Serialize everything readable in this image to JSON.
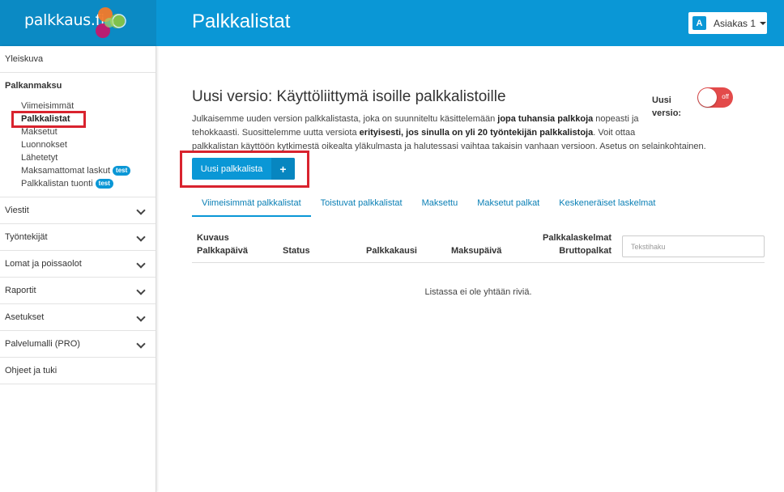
{
  "app": {
    "logo_text": "palkkaus.fi",
    "page_title": "Palkkalistat",
    "account_badge": "A",
    "account_name": "Asiakas 1",
    "brand_color": "#0a97d6"
  },
  "sidebar": {
    "items": [
      {
        "label": "Yleiskuva"
      },
      {
        "label": "Viestit"
      },
      {
        "label": "Työntekijät"
      },
      {
        "label": "Lomat ja poissaolot"
      },
      {
        "label": "Raportit"
      },
      {
        "label": "Asetukset"
      },
      {
        "label": "Palvelumalli (PRO)"
      },
      {
        "label": "Ohjeet ja tuki"
      }
    ],
    "group": {
      "label": "Palkanmaksu",
      "subitems": [
        {
          "label": "Viimeisimmät"
        },
        {
          "label": "Palkkalistat"
        },
        {
          "label": "Maksetut"
        },
        {
          "label": "Luonnokset"
        },
        {
          "label": "Lähetetyt"
        },
        {
          "label": "Maksamattomat laskut",
          "tag": "test"
        },
        {
          "label": "Palkkalistan tuonti",
          "tag": "test"
        }
      ]
    }
  },
  "main": {
    "heading": "Uusi versio: Käyttöliittymä isoille palkkalistoille",
    "para1": {
      "t1": "Julkaisemme uuden version palkkalistasta, joka on suunniteltu käsittelemään ",
      "b1": "jopa tuhansia palkkoja",
      "t2": " nopeasti ja"
    },
    "para2": {
      "t1": "tehokkaasti. Suosittelemme uutta versiota ",
      "b1": "erityisesti, jos sinulla on yli 20 työntekijän palkkalistoja",
      "t2": ". Voit ottaa"
    },
    "para3": "palkkalistan käyttöön kytkimestä oikealta yläkulmasta ja halutessasi vaihtaa takaisin vanhaan versioon. Asetus on selainkohtainen.",
    "toggle_label_1": "Uusi",
    "toggle_label_2": "versio:",
    "toggle_state": "off",
    "new_button_label": "Uusi palkkalista",
    "new_button_icon": "+",
    "tabs": [
      {
        "label": "Viimeisimmät palkkalistat",
        "active": true
      },
      {
        "label": "Toistuvat palkkalistat"
      },
      {
        "label": "Maksettu"
      },
      {
        "label": "Maksetut palkat"
      },
      {
        "label": "Keskeneräiset laskelmat"
      }
    ],
    "columns": {
      "kuvaus": "Kuvaus",
      "palkkapaiva": "Palkkapäivä",
      "status": "Status",
      "palkkakausi": "Palkkakausi",
      "maksupaiva": "Maksupäivä",
      "palkkalaskelmat": "Palkkalaskelmat",
      "bruttopalkat": "Bruttopalkat"
    },
    "search_placeholder": "Tekstihaku",
    "empty_text": "Listassa ei ole yhtään riviä."
  }
}
